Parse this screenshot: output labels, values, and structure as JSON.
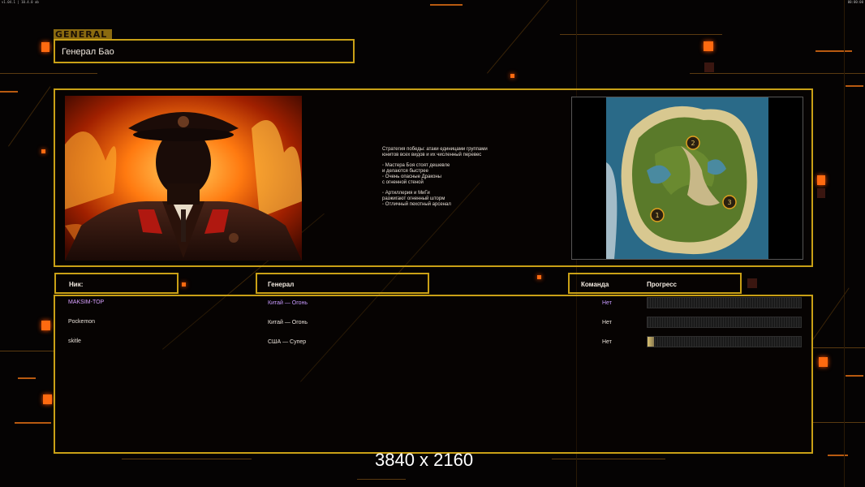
{
  "top_bar": {
    "left_text": "v1.04.1 | 10.4.0 ab",
    "right_text": "00:00:00"
  },
  "header": {
    "tag": "GENERAL",
    "general_name": "Генерал Бао"
  },
  "description": {
    "lines1": [
      "Стратегия победы: атаки единицами группами",
      "юнитов всех видов и их численный перевес"
    ],
    "lines2": [
      "◦ Мастера Боя стоят дешевле",
      "и делаются быстрее",
      "◦ Очень опасные Драконы",
      "с огненной стеной"
    ],
    "lines3": [
      "◦ Артиллерия и МиГи",
      "разжигают огненный шторм",
      "◦ Отличный пехотный арсенал"
    ]
  },
  "map": {
    "start_positions": [
      "1",
      "2",
      "3"
    ]
  },
  "columns": {
    "nick": "Ник:",
    "general": "Генерал",
    "team": "Команда",
    "progress": "Прогресс"
  },
  "players": [
    {
      "nick": "MAKSIM-TOP",
      "general": "Китай — Огонь",
      "team": "Нет",
      "progress": 0.0,
      "nick_color": "#d8a0ff",
      "general_color": "#c89aff",
      "team_color": "#c89aff"
    },
    {
      "nick": "Pockemon",
      "general": "Китай — Огонь",
      "team": "Нет",
      "progress": 0.0,
      "nick_color": "#e8e0d8",
      "general_color": "#e8e0d8",
      "team_color": "#e8e0d8"
    },
    {
      "nick": "skitle",
      "general": "США — Супер",
      "team": "Нет",
      "progress": 0.04,
      "nick_color": "#e8e0d8",
      "general_color": "#e8e0d8",
      "team_color": "#e8e0d8"
    }
  ],
  "resolution_label": "3840 x 2160",
  "colors": {
    "accent_gold": "#c9a016",
    "accent_orange": "#ff6a10",
    "highlight_purple": "#c89aff"
  }
}
